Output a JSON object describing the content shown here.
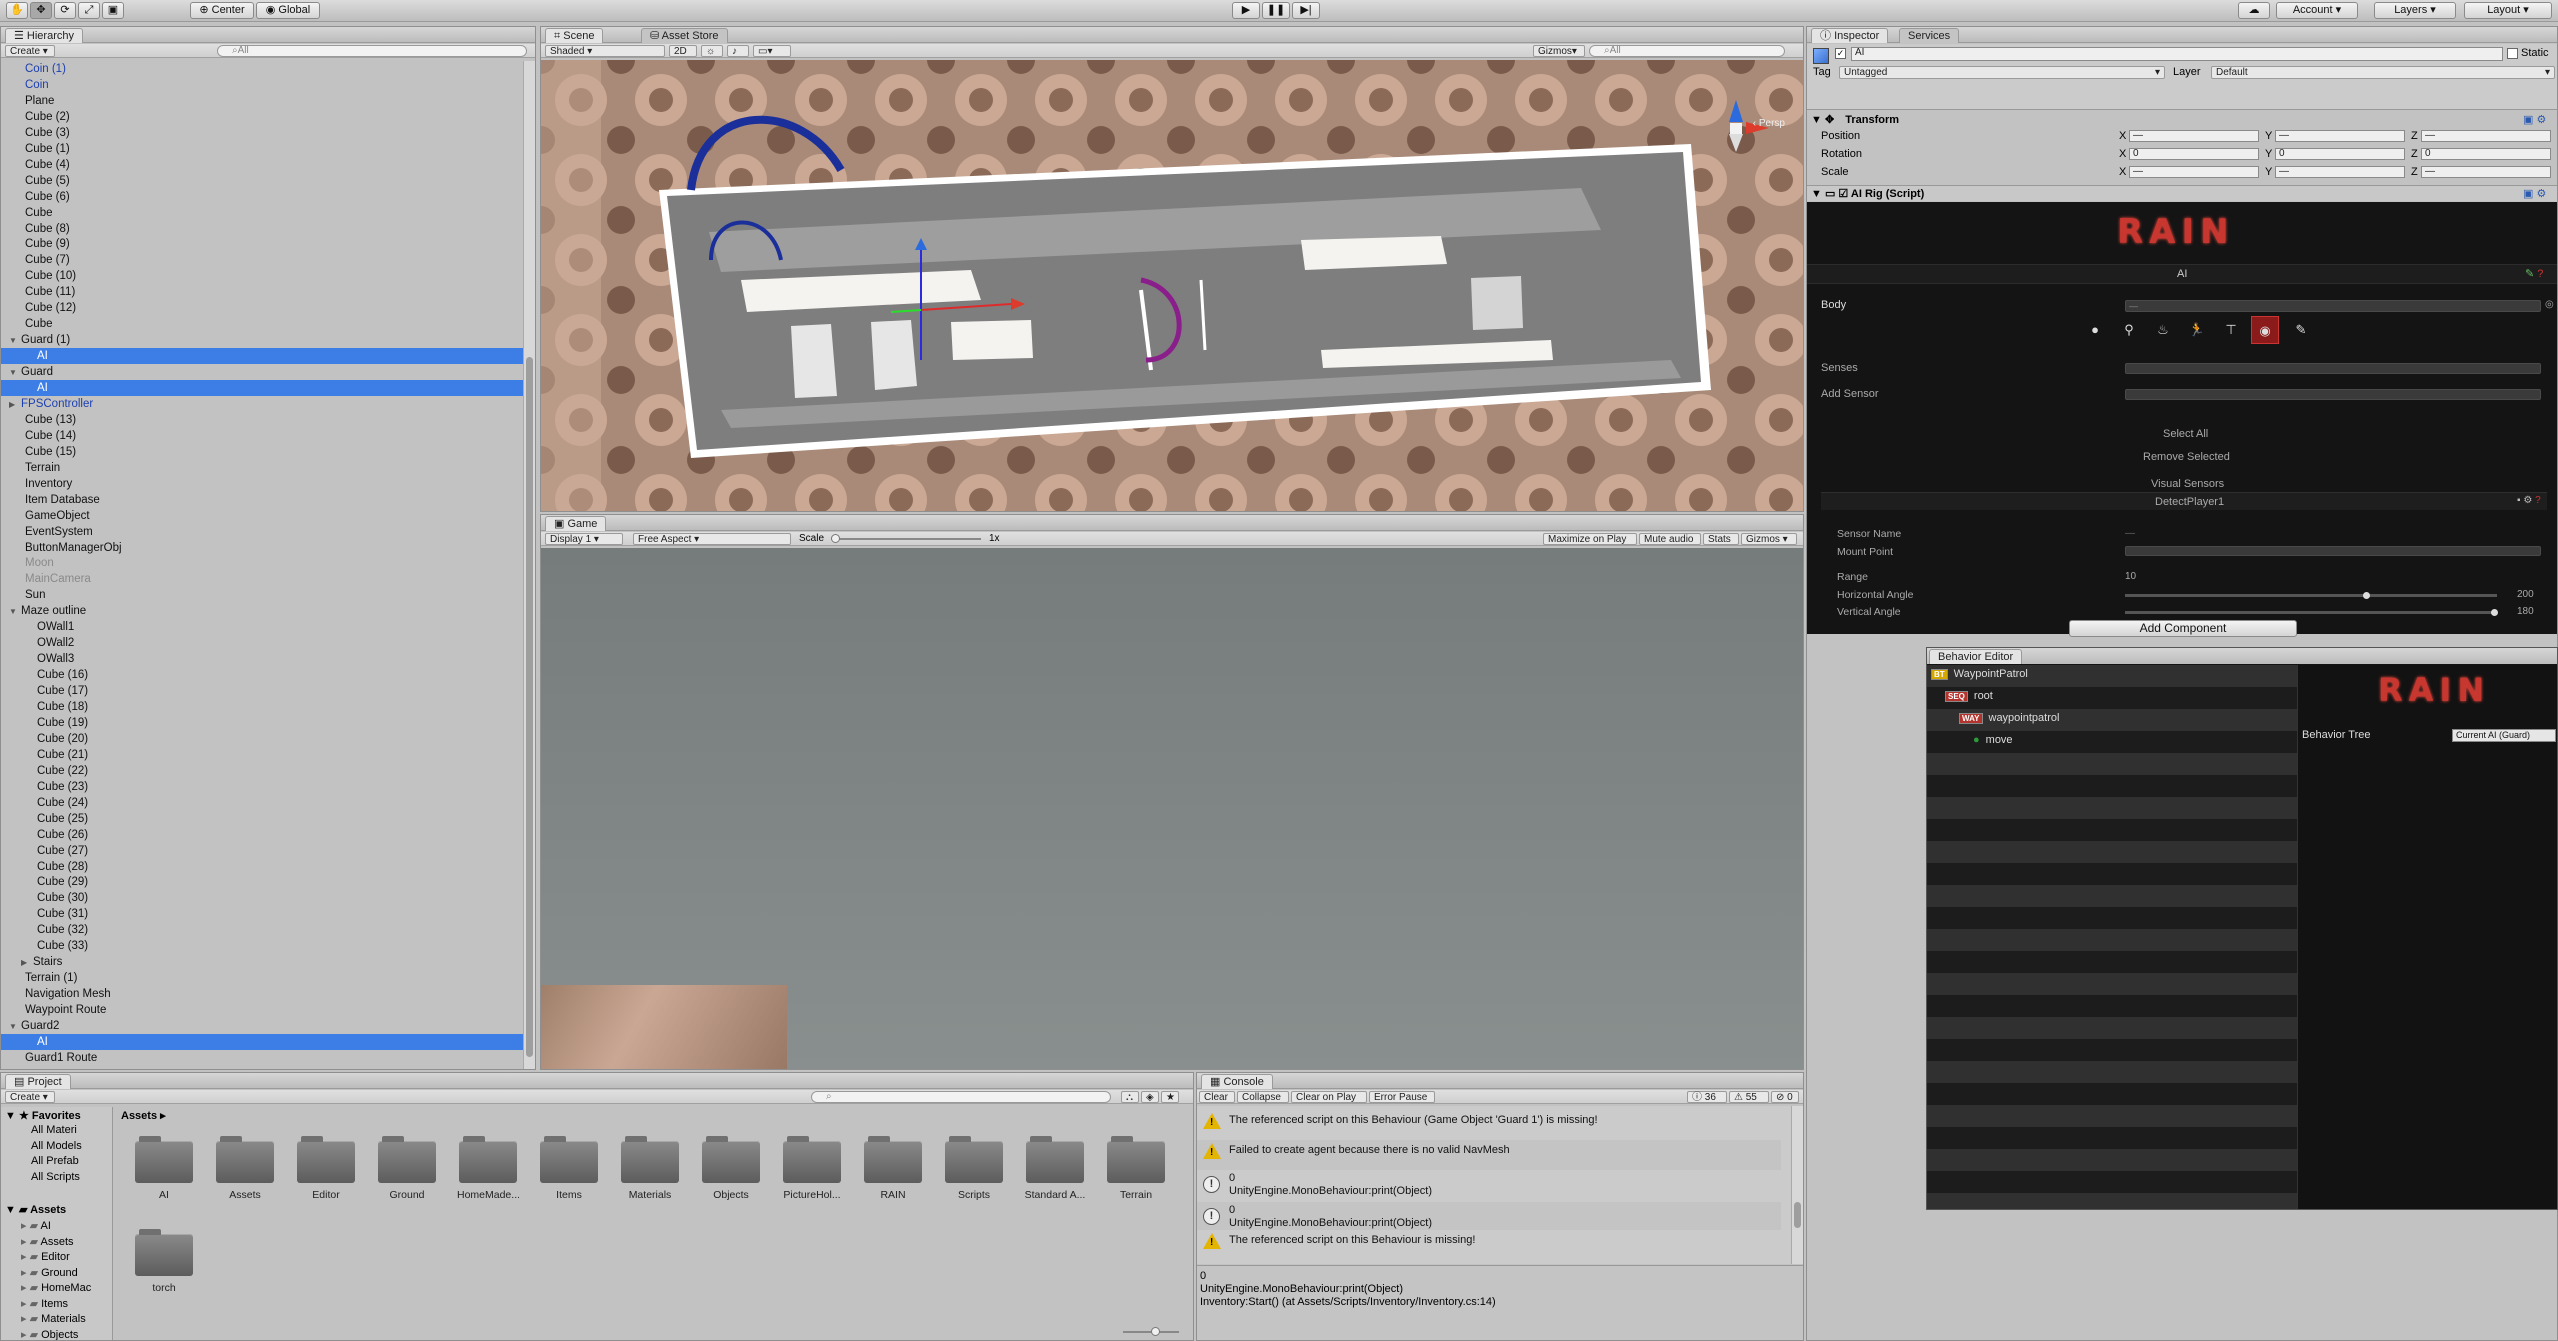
{
  "toolbar": {
    "center": "Center",
    "global": "Global",
    "account": "Account",
    "layers": "Layers",
    "layout": "Layout"
  },
  "hierarchy": {
    "tab": "Hierarchy",
    "create": "Create",
    "search": "⌕All",
    "rows": [
      {
        "label": "Coin (1)",
        "indent": 1,
        "style": "blue"
      },
      {
        "label": "Coin",
        "indent": 1,
        "style": "blue"
      },
      {
        "label": "Plane",
        "indent": 1,
        "style": ""
      },
      {
        "label": "Cube (2)",
        "indent": 1,
        "style": ""
      },
      {
        "label": "Cube (3)",
        "indent": 1,
        "style": ""
      },
      {
        "label": "Cube (1)",
        "indent": 1,
        "style": ""
      },
      {
        "label": "Cube (4)",
        "indent": 1,
        "style": ""
      },
      {
        "label": "Cube (5)",
        "indent": 1,
        "style": ""
      },
      {
        "label": "Cube (6)",
        "indent": 1,
        "style": ""
      },
      {
        "label": "Cube",
        "indent": 1,
        "style": ""
      },
      {
        "label": "Cube (8)",
        "indent": 1,
        "style": ""
      },
      {
        "label": "Cube (9)",
        "indent": 1,
        "style": ""
      },
      {
        "label": "Cube (7)",
        "indent": 1,
        "style": ""
      },
      {
        "label": "Cube (10)",
        "indent": 1,
        "style": ""
      },
      {
        "label": "Cube (11)",
        "indent": 1,
        "style": ""
      },
      {
        "label": "Cube (12)",
        "indent": 1,
        "style": ""
      },
      {
        "label": "Cube",
        "indent": 1,
        "style": ""
      },
      {
        "label": "Guard (1)",
        "indent": 1,
        "style": "",
        "tri": "▼"
      },
      {
        "label": "AI",
        "indent": 2,
        "style": "sel"
      },
      {
        "label": "Guard",
        "indent": 1,
        "style": "",
        "tri": "▼"
      },
      {
        "label": "AI",
        "indent": 2,
        "style": "sel"
      },
      {
        "label": "FPSController",
        "indent": 1,
        "style": "blue",
        "tri": "▶"
      },
      {
        "label": "Cube (13)",
        "indent": 1,
        "style": ""
      },
      {
        "label": "Cube (14)",
        "indent": 1,
        "style": ""
      },
      {
        "label": "Cube (15)",
        "indent": 1,
        "style": ""
      },
      {
        "label": "Terrain",
        "indent": 1,
        "style": ""
      },
      {
        "label": "Inventory",
        "indent": 1,
        "style": ""
      },
      {
        "label": "Item Database",
        "indent": 1,
        "style": ""
      },
      {
        "label": "GameObject",
        "indent": 1,
        "style": ""
      },
      {
        "label": "EventSystem",
        "indent": 1,
        "style": ""
      },
      {
        "label": "ButtonManagerObj",
        "indent": 1,
        "style": ""
      },
      {
        "label": "Moon",
        "indent": 1,
        "style": "gray"
      },
      {
        "label": "MainCamera",
        "indent": 1,
        "style": "gray"
      },
      {
        "label": "Sun",
        "indent": 1,
        "style": ""
      },
      {
        "label": "Maze outline",
        "indent": 1,
        "style": "",
        "tri": "▼"
      },
      {
        "label": "OWall1",
        "indent": 2,
        "style": ""
      },
      {
        "label": "OWall2",
        "indent": 2,
        "style": ""
      },
      {
        "label": "OWall3",
        "indent": 2,
        "style": ""
      },
      {
        "label": "Cube (16)",
        "indent": 2,
        "style": ""
      },
      {
        "label": "Cube (17)",
        "indent": 2,
        "style": ""
      },
      {
        "label": "Cube (18)",
        "indent": 2,
        "style": ""
      },
      {
        "label": "Cube (19)",
        "indent": 2,
        "style": ""
      },
      {
        "label": "Cube (20)",
        "indent": 2,
        "style": ""
      },
      {
        "label": "Cube (21)",
        "indent": 2,
        "style": ""
      },
      {
        "label": "Cube (22)",
        "indent": 2,
        "style": ""
      },
      {
        "label": "Cube (23)",
        "indent": 2,
        "style": ""
      },
      {
        "label": "Cube (24)",
        "indent": 2,
        "style": ""
      },
      {
        "label": "Cube (25)",
        "indent": 2,
        "style": ""
      },
      {
        "label": "Cube (26)",
        "indent": 2,
        "style": ""
      },
      {
        "label": "Cube (27)",
        "indent": 2,
        "style": ""
      },
      {
        "label": "Cube (28)",
        "indent": 2,
        "style": ""
      },
      {
        "label": "Cube (29)",
        "indent": 2,
        "style": ""
      },
      {
        "label": "Cube (30)",
        "indent": 2,
        "style": ""
      },
      {
        "label": "Cube (31)",
        "indent": 2,
        "style": ""
      },
      {
        "label": "Cube (32)",
        "indent": 2,
        "style": ""
      },
      {
        "label": "Cube (33)",
        "indent": 2,
        "style": ""
      },
      {
        "label": "Stairs",
        "indent": 2,
        "style": "",
        "tri": "▶"
      },
      {
        "label": "Terrain (1)",
        "indent": 1,
        "style": ""
      },
      {
        "label": "Navigation Mesh",
        "indent": 1,
        "style": ""
      },
      {
        "label": "Waypoint Route",
        "indent": 1,
        "style": ""
      },
      {
        "label": "Guard2",
        "indent": 1,
        "style": "",
        "tri": "▼"
      },
      {
        "label": "AI",
        "indent": 2,
        "style": "sel"
      },
      {
        "label": "Guard1 Route",
        "indent": 1,
        "style": ""
      }
    ]
  },
  "scene": {
    "tab": "Scene",
    "tab2": "Asset Store",
    "shading": "Shaded",
    "mode2d": "2D",
    "gizmos": "Gizmos",
    "search": "⌕All",
    "persp": "‹ Persp"
  },
  "game": {
    "tab": "Game",
    "display": "Display 1",
    "aspect": "Free Aspect",
    "scale_label": "Scale",
    "scale_value": "1x",
    "maximize": "Maximize on Play",
    "mute": "Mute audio",
    "stats": "Stats",
    "gizmos": "Gizmos"
  },
  "project": {
    "tab": "Project",
    "create": "Create",
    "favorites_title": "Favorites",
    "favorites": [
      "All Materi",
      "All Models",
      "All Prefab",
      "All Scripts"
    ],
    "assets_title": "Assets",
    "tree": [
      "AI",
      "Assets",
      "Editor",
      "Ground",
      "HomeMac",
      "Items",
      "Materials",
      "Objects"
    ],
    "breadcrumb": "Assets ▸",
    "folders": [
      "AI",
      "Assets",
      "Editor",
      "Ground",
      "HomeMade...",
      "Items",
      "Materials",
      "Objects",
      "PictureHol...",
      "RAIN",
      "Scripts",
      "Standard A...",
      "Terrain",
      "torch"
    ]
  },
  "console": {
    "tab": "Console",
    "clear": "Clear",
    "collapse": "Collapse",
    "clear_on_play": "Clear on Play",
    "error_pause": "Error Pause",
    "count_info": "36",
    "count_warn": "55",
    "count_err": "0",
    "entries": [
      {
        "icon": "warn",
        "line1": "The referenced script on this Behaviour (Game Object 'Guard 1') is missing!",
        "line2": ""
      },
      {
        "icon": "warn",
        "line1": "Failed to create agent because there is no valid NavMesh",
        "line2": ""
      },
      {
        "icon": "info",
        "line1": "0",
        "line2": "UnityEngine.MonoBehaviour:print(Object)"
      },
      {
        "icon": "info",
        "line1": "0",
        "line2": "UnityEngine.MonoBehaviour:print(Object)"
      },
      {
        "icon": "warn",
        "line1": "The referenced script on this Behaviour is missing!",
        "line2": ""
      }
    ],
    "detail": [
      "0",
      "UnityEngine.MonoBehaviour:print(Object)",
      "Inventory:Start() (at Assets/Scripts/Inventory/Inventory.cs:14)"
    ]
  },
  "inspector": {
    "tab": "Inspector",
    "tab2": "Services",
    "name": "AI",
    "static": "Static",
    "tag_label": "Tag",
    "tag": "Untagged",
    "layer_label": "Layer",
    "layer": "Default",
    "transform_title": "Transform",
    "rows": [
      {
        "label": "Position",
        "x": "—",
        "y": "—",
        "z": "—"
      },
      {
        "label": "Rotation",
        "x": "0",
        "y": "0",
        "z": "0"
      },
      {
        "label": "Scale",
        "x": "—",
        "y": "—",
        "z": "—"
      }
    ],
    "ai_rig": "AI Rig (Script)",
    "add_component": "Add Component"
  },
  "rain": {
    "logo": "RAIN",
    "ai_label": "AI",
    "body": "Body",
    "body_value": "—",
    "senses": "Senses",
    "add_sensor": "Add Sensor",
    "select_all": "Select All",
    "remove_selected": "Remove Selected",
    "visual_sensors": "Visual Sensors",
    "sensor": "DetectPlayer1",
    "sensor_name": "Sensor Name",
    "sensor_name_value": "—",
    "mount_point": "Mount Point",
    "range": "Range",
    "range_value": "10",
    "h_angle": "Horizontal Angle",
    "h_angle_value": "200",
    "v_angle": "Vertical Angle",
    "v_angle_value": "180"
  },
  "behavior": {
    "tab": "Behavior Editor",
    "nodes": [
      {
        "tag": "BT",
        "label": "WaypointPatrol",
        "depth": 0,
        "color": "#d4a800"
      },
      {
        "tag": "SEQ",
        "label": "root",
        "depth": 1,
        "color": "#b3342c"
      },
      {
        "tag": "WAY",
        "label": "waypointpatrol",
        "depth": 2,
        "color": "#b3342c"
      },
      {
        "tag": "",
        "label": "move",
        "depth": 3,
        "color": "#2a9d3a"
      }
    ],
    "logo": "RAIN",
    "tree_label": "Behavior Tree",
    "tree_value": "Current AI (Guard)"
  }
}
